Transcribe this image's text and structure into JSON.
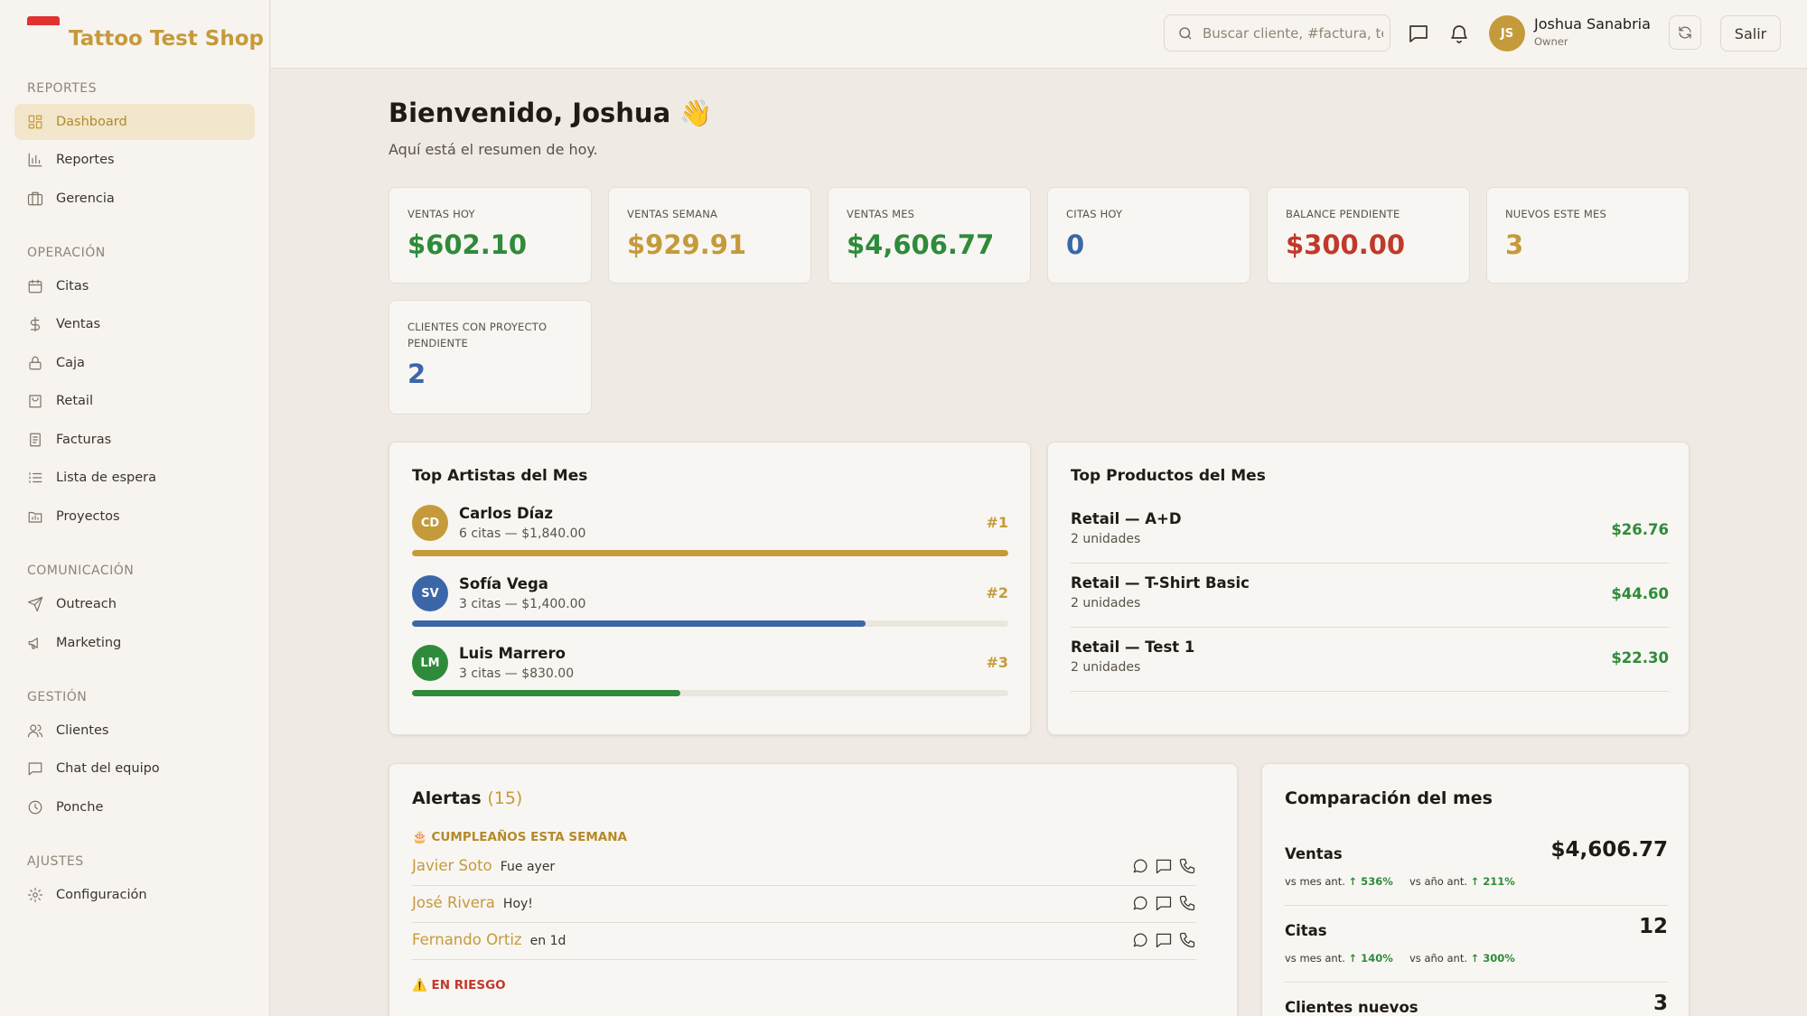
{
  "app": {
    "name": "Tattoo Test Shop"
  },
  "sidebar": {
    "sections": [
      "REPORTES",
      "OPERACIÓN",
      "COMUNICACIÓN",
      "GESTIÓN",
      "AJUSTES"
    ],
    "items": [
      {
        "label": "Dashboard",
        "icon": "dashboard-icon"
      },
      {
        "label": "Reportes",
        "icon": "bar-chart-icon"
      },
      {
        "label": "Gerencia",
        "icon": "briefcase-icon"
      },
      {
        "label": "Citas",
        "icon": "calendar-icon"
      },
      {
        "label": "Ventas",
        "icon": "dollar-icon"
      },
      {
        "label": "Caja",
        "icon": "lock-icon"
      },
      {
        "label": "Retail",
        "icon": "shopping-bag-icon"
      },
      {
        "label": "Facturas",
        "icon": "receipt-icon"
      },
      {
        "label": "Lista de espera",
        "icon": "list-icon"
      },
      {
        "label": "Proyectos",
        "icon": "folder-icon"
      },
      {
        "label": "Outreach",
        "icon": "send-icon"
      },
      {
        "label": "Marketing",
        "icon": "megaphone-icon"
      },
      {
        "label": "Clientes",
        "icon": "users-icon"
      },
      {
        "label": "Chat del equipo",
        "icon": "chat-icon"
      },
      {
        "label": "Ponche",
        "icon": "clock-icon"
      },
      {
        "label": "Configuración",
        "icon": "gear-icon"
      }
    ]
  },
  "header": {
    "search_placeholder": "Buscar cliente, #factura, teléfono...",
    "user_initials": "JS",
    "user_name": "Joshua Sanabria",
    "user_role": "Owner",
    "logout_label": "Salir"
  },
  "main": {
    "welcome": "Bienvenido, Joshua 👋",
    "subtitle": "Aquí está el resumen de hoy."
  },
  "stats": [
    {
      "label": "VENTAS HOY",
      "value": "$602.10",
      "color": "#2e8b3a"
    },
    {
      "label": "VENTAS SEMANA",
      "value": "$929.91",
      "color": "#c59a3b"
    },
    {
      "label": "VENTAS MES",
      "value": "$4,606.77",
      "color": "#2e8b3a"
    },
    {
      "label": "CITAS HOY",
      "value": "0",
      "color": "#3b67a8"
    },
    {
      "label": "BALANCE PENDIENTE",
      "value": "$300.00",
      "color": "#c0392b"
    },
    {
      "label": "NUEVOS ESTE MES",
      "value": "3",
      "color": "#c59a3b"
    },
    {
      "label": "CLIENTES CON PROYECTO PENDIENTE",
      "value": "2",
      "color": "#3b67a8"
    }
  ],
  "top_artists": {
    "title": "Top Artistas del Mes",
    "items": [
      {
        "initials": "CD",
        "name": "Carlos Díaz",
        "detail": "6 citas — $1,840.00",
        "rank": "#1",
        "color": "#c59a3b",
        "progress": 1.0
      },
      {
        "initials": "SV",
        "name": "Sofía Vega",
        "detail": "3 citas — $1,400.00",
        "rank": "#2",
        "color": "#3b67a8",
        "progress": 0.76
      },
      {
        "initials": "LM",
        "name": "Luis Marrero",
        "detail": "3 citas — $830.00",
        "rank": "#3",
        "color": "#2e8b3a",
        "progress": 0.45
      }
    ]
  },
  "top_products": {
    "title": "Top Productos del Mes",
    "items": [
      {
        "name": "Retail — A+D",
        "units": "2 unidades",
        "price": "$26.76"
      },
      {
        "name": "Retail — T-Shirt Basic",
        "units": "2 unidades",
        "price": "$44.60"
      },
      {
        "name": "Retail — Test 1",
        "units": "2 unidades",
        "price": "$22.30"
      }
    ]
  },
  "alerts": {
    "title": "Alertas",
    "count": "(15)",
    "birthday_section": "🎂 CUMPLEAÑOS ESTA SEMANA",
    "risk_section": "⚠️ EN RIESGO",
    "birthdays": [
      {
        "name": "Javier Soto",
        "when": "Fue ayer"
      },
      {
        "name": "José Rivera",
        "when": "Hoy!"
      },
      {
        "name": "Fernando Ortiz",
        "when": "en 1d"
      }
    ]
  },
  "comparison": {
    "title": "Comparación del mes",
    "rows": [
      {
        "name": "Ventas",
        "value": "$4,606.77",
        "prev_label": "vs mes ant.",
        "prev": "↑ 536%",
        "year_label": "vs año ant.",
        "year": "↑ 211%"
      },
      {
        "name": "Citas",
        "value": "12",
        "prev_label": "vs mes ant.",
        "prev": "↑ 140%",
        "year_label": "vs año ant.",
        "year": "↑ 300%"
      },
      {
        "name": "Clientes nuevos",
        "value": "3",
        "prev_label": "",
        "prev": "",
        "year_label": "",
        "year": ""
      }
    ]
  }
}
